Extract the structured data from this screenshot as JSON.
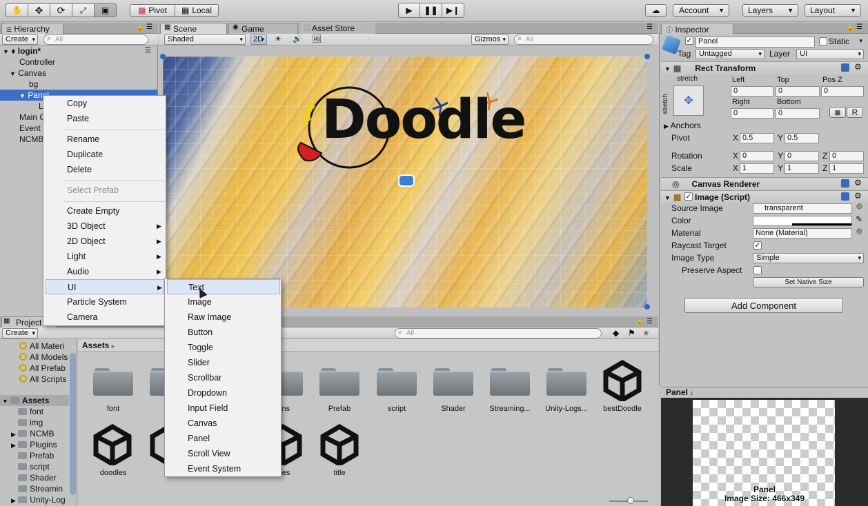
{
  "toolbar": {
    "pivot": "Pivot",
    "local": "Local",
    "account": "Account",
    "layers": "Layers",
    "layout": "Layout"
  },
  "hierarchy": {
    "tab": "Hierarchy",
    "create": "Create",
    "search_placeholder": "⌕All",
    "scene_name": "login*",
    "items": [
      "Controller",
      "Canvas",
      "bg",
      "Panel",
      "L",
      "Main C",
      "Event",
      "NCMB"
    ]
  },
  "scene": {
    "tabs": [
      "Scene",
      "Game",
      "Asset Store"
    ],
    "shaded": "Shaded",
    "mode_2d": "2D",
    "gizmos": "Gizmos",
    "search_placeholder": "⌕All",
    "logo_text": "Doodle"
  },
  "context_menu": {
    "items": [
      {
        "label": "Copy"
      },
      {
        "label": "Paste"
      },
      {
        "label": "Rename"
      },
      {
        "label": "Duplicate"
      },
      {
        "label": "Delete"
      },
      {
        "label": "Select Prefab"
      },
      {
        "label": "Create Empty"
      },
      {
        "label": "3D Object"
      },
      {
        "label": "2D Object"
      },
      {
        "label": "Light"
      },
      {
        "label": "Audio"
      },
      {
        "label": "UI"
      },
      {
        "label": "Particle System"
      },
      {
        "label": "Camera"
      }
    ]
  },
  "ui_submenu": {
    "items": [
      "Text",
      "Image",
      "Raw Image",
      "Button",
      "Toggle",
      "Slider",
      "Scrollbar",
      "Dropdown",
      "Input Field",
      "Canvas",
      "Panel",
      "Scroll View",
      "Event System"
    ]
  },
  "project": {
    "tab": "Project",
    "create": "Create",
    "favorites": [
      "All Materi",
      "All Models",
      "All Prefab",
      "All Scripts"
    ],
    "assets_root": "Assets",
    "tree": [
      "font",
      "img",
      "NCMB",
      "Plugins",
      "Prefab",
      "script",
      "Shader",
      "Streamin",
      "Unity-Log"
    ],
    "breadcrumb": "Assets",
    "assets": [
      {
        "label": "font"
      },
      {
        "label": ""
      },
      {
        "label": "gins"
      },
      {
        "label": "Prefab"
      },
      {
        "label": "script"
      },
      {
        "label": "Shader"
      },
      {
        "label": "Streaming..."
      },
      {
        "label": "Unity-Logs..."
      },
      {
        "label": "bestDoodle"
      },
      {
        "label": "doodles"
      },
      {
        "label": "mes"
      },
      {
        "label": "title"
      }
    ]
  },
  "inspector": {
    "tab": "Inspector",
    "object_name": "Panel",
    "static": "Static",
    "tag_label": "Tag",
    "tag_value": "Untagged",
    "layer_label": "Layer",
    "layer_value": "UI",
    "rect_transform": "Rect Transform",
    "stretch": "stretch",
    "stretch_v": "stretch",
    "left": "Left",
    "left_v": "0",
    "top": "Top",
    "top_v": "0",
    "posz": "Pos Z",
    "posz_v": "0",
    "right": "Right",
    "right_v": "0",
    "bottom": "Bottom",
    "bottom_v": "0",
    "r_btn": "R",
    "anchors": "Anchors",
    "pivot": "Pivot",
    "pivot_x": "0.5",
    "pivot_y": "0.5",
    "rotation": "Rotation",
    "rot_x": "0",
    "rot_y": "0",
    "rot_z": "0",
    "scale": "Scale",
    "scale_x": "1",
    "scale_y": "1",
    "scale_z": "1",
    "x": "X",
    "y": "Y",
    "z": "Z",
    "canvas_renderer": "Canvas Renderer",
    "image_script": "Image (Script)",
    "source_image": "Source Image",
    "source_image_v": "transparent",
    "color": "Color",
    "material": "Material",
    "material_v": "None (Material)",
    "raycast": "Raycast Target",
    "image_type": "Image Type",
    "image_type_v": "Simple",
    "preserve": "Preserve Aspect",
    "set_native": "Set Native Size",
    "add_component": "Add Component",
    "preview_title": "Panel",
    "preview_caption1": "Panel",
    "preview_caption2": "Image Size: 466x349"
  }
}
